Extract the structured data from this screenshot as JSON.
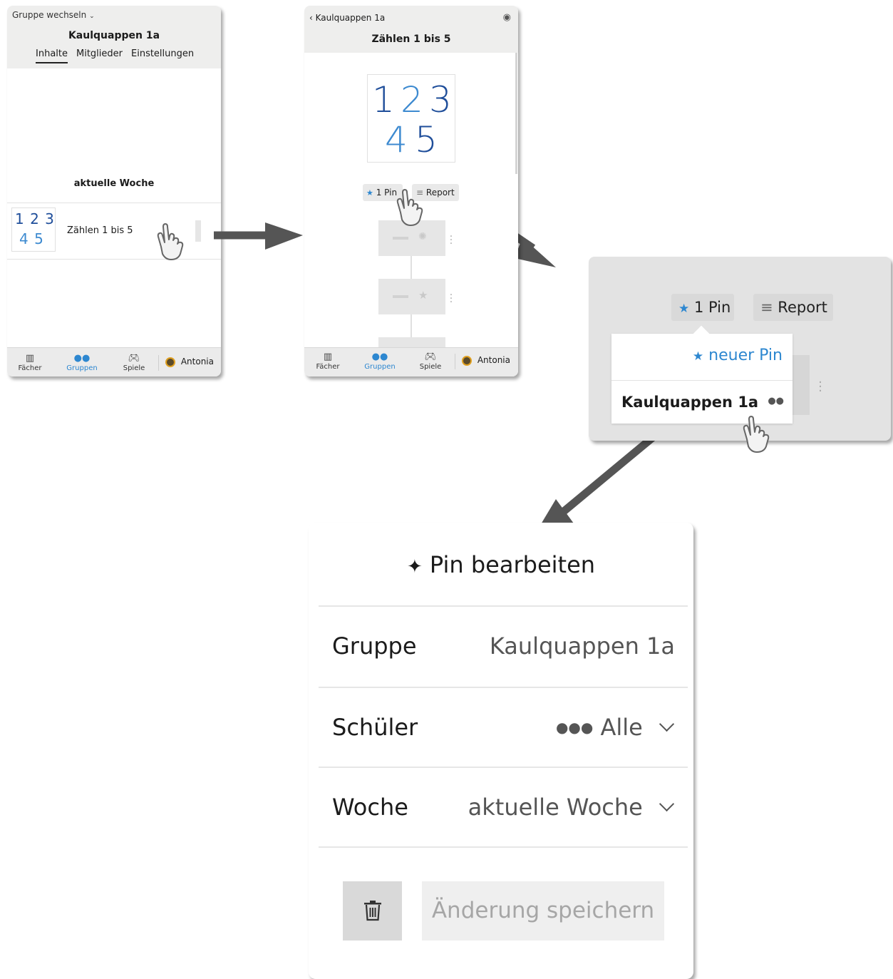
{
  "screen1": {
    "group_switch": "Gruppe wechseln",
    "title": "Kaulquappen 1a",
    "tabs": [
      "Inhalte",
      "Mitglieder",
      "Einstellungen"
    ],
    "section_title": "aktuelle Woche",
    "item_label": "Zählen 1 bis 5",
    "thumb_row1": "1 2 3",
    "thumb_row2": "4 5"
  },
  "screen2": {
    "back_label": "Kaulquappen 1a",
    "title": "Zählen 1 bis 5",
    "pin_chip": "1 Pin",
    "report_chip": "Report",
    "digits": [
      "1",
      "2",
      "3",
      "4",
      "5"
    ]
  },
  "bottom_nav": {
    "faecher": "Fächer",
    "gruppen": "Gruppen",
    "spiele": "Spiele",
    "user": "Antonia"
  },
  "popover": {
    "pin_chip": "1 Pin",
    "report_chip": "Report",
    "new_pin": "neuer Pin",
    "group_entry": "Kaulquappen 1a"
  },
  "dialog": {
    "title": "Pin bearbeiten",
    "group_label": "Gruppe",
    "group_value": "Kaulquappen 1a",
    "students_label": "Schüler",
    "students_value": "Alle",
    "week_label": "Woche",
    "week_value": "aktuelle Woche",
    "save_button": "Änderung speichern"
  },
  "colors": {
    "accent_blue": "#2d87d0",
    "header_grey": "#eeeeed",
    "arrow_grey": "#555555",
    "digit_dark_blue": "#1f4e9a",
    "digit_light_blue": "#3d8ad0"
  },
  "icons": {
    "pin": "pin-icon",
    "report": "list-icon",
    "group": "group-icon",
    "trash": "trash-icon",
    "eye": "eye-icon",
    "hand": "hand-pointer-icon"
  }
}
